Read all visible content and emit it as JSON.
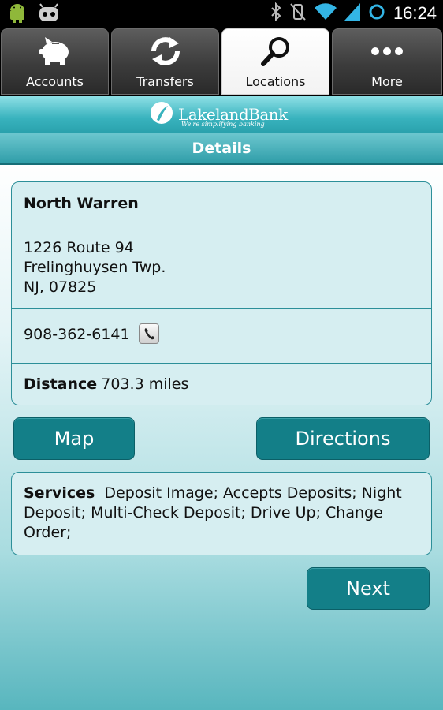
{
  "status_bar": {
    "time": "16:24",
    "left_icons": [
      "android-robot-icon",
      "cyanogen-mascot-icon"
    ],
    "right_icons": [
      "bluetooth-icon",
      "vibrate-off-icon",
      "wifi-icon",
      "signal-icon",
      "sync-ring-icon"
    ]
  },
  "tabs": [
    {
      "label": "Accounts",
      "icon": "piggy-bank-icon",
      "active": false
    },
    {
      "label": "Transfers",
      "icon": "transfer-arrows-icon",
      "active": false
    },
    {
      "label": "Locations",
      "icon": "magnifier-icon",
      "active": true
    },
    {
      "label": "More",
      "icon": "more-dots-icon",
      "active": false
    }
  ],
  "brand": {
    "name": "LakelandBank",
    "tagline": "We're simplifying banking"
  },
  "page_title": "Details",
  "location": {
    "name": "North Warren",
    "address_line1": "1226 Route 94",
    "address_line2": "Frelinghuysen Twp.",
    "address_line3": "NJ, 07825",
    "phone": "908-362-6141",
    "distance_label": "Distance",
    "distance_value": "703.3 miles"
  },
  "buttons": {
    "map": "Map",
    "directions": "Directions",
    "next": "Next"
  },
  "services": {
    "label": "Services",
    "value": "Deposit Image; Accepts Deposits; Night Deposit; Multi-Check Deposit; Drive Up; Change Order;"
  },
  "colors": {
    "accent": "#137f88",
    "header": "#39b3be",
    "card_bg": "#d6eef1"
  }
}
